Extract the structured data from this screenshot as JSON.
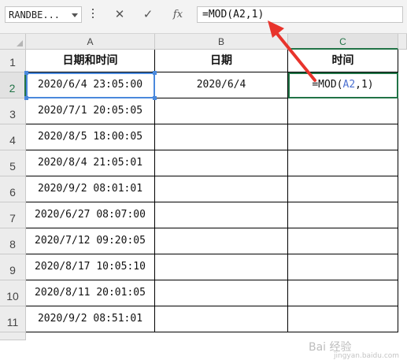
{
  "formula_bar": {
    "name_box": "RANDBE...",
    "cancel_icon": "✕",
    "enter_icon": "✓",
    "fx_icon": "fx",
    "formula": "=MOD(A2,1)"
  },
  "columns": [
    "A",
    "B",
    "C"
  ],
  "rows": [
    "1",
    "2",
    "3",
    "4",
    "5",
    "6",
    "7",
    "8",
    "9",
    "10",
    "11"
  ],
  "headers": {
    "A": "日期和时间",
    "B": "日期",
    "C": "时间"
  },
  "data": [
    {
      "a": "2020/6/4 23:05:00",
      "b": "2020/6/4",
      "c_prefix": "=MOD(",
      "c_ref": "A2",
      "c_suffix": ",1)"
    },
    {
      "a": "2020/7/1 20:05:05"
    },
    {
      "a": "2020/8/5 18:00:05"
    },
    {
      "a": "2020/8/4 21:05:01"
    },
    {
      "a": "2020/9/2 08:01:01"
    },
    {
      "a": "2020/6/27 08:07:00"
    },
    {
      "a": "2020/7/12 09:20:05"
    },
    {
      "a": "2020/8/17 10:05:10"
    },
    {
      "a": "2020/8/11 20:01:05"
    },
    {
      "a": "2020/9/2 08:51:01"
    }
  ],
  "watermark": {
    "line1": "Bai 经验",
    "line2": "jingyan.baidu.com"
  },
  "colors": {
    "accent_green": "#217346",
    "selection_blue": "#4a89dc",
    "annotation_red": "#e8342c"
  }
}
